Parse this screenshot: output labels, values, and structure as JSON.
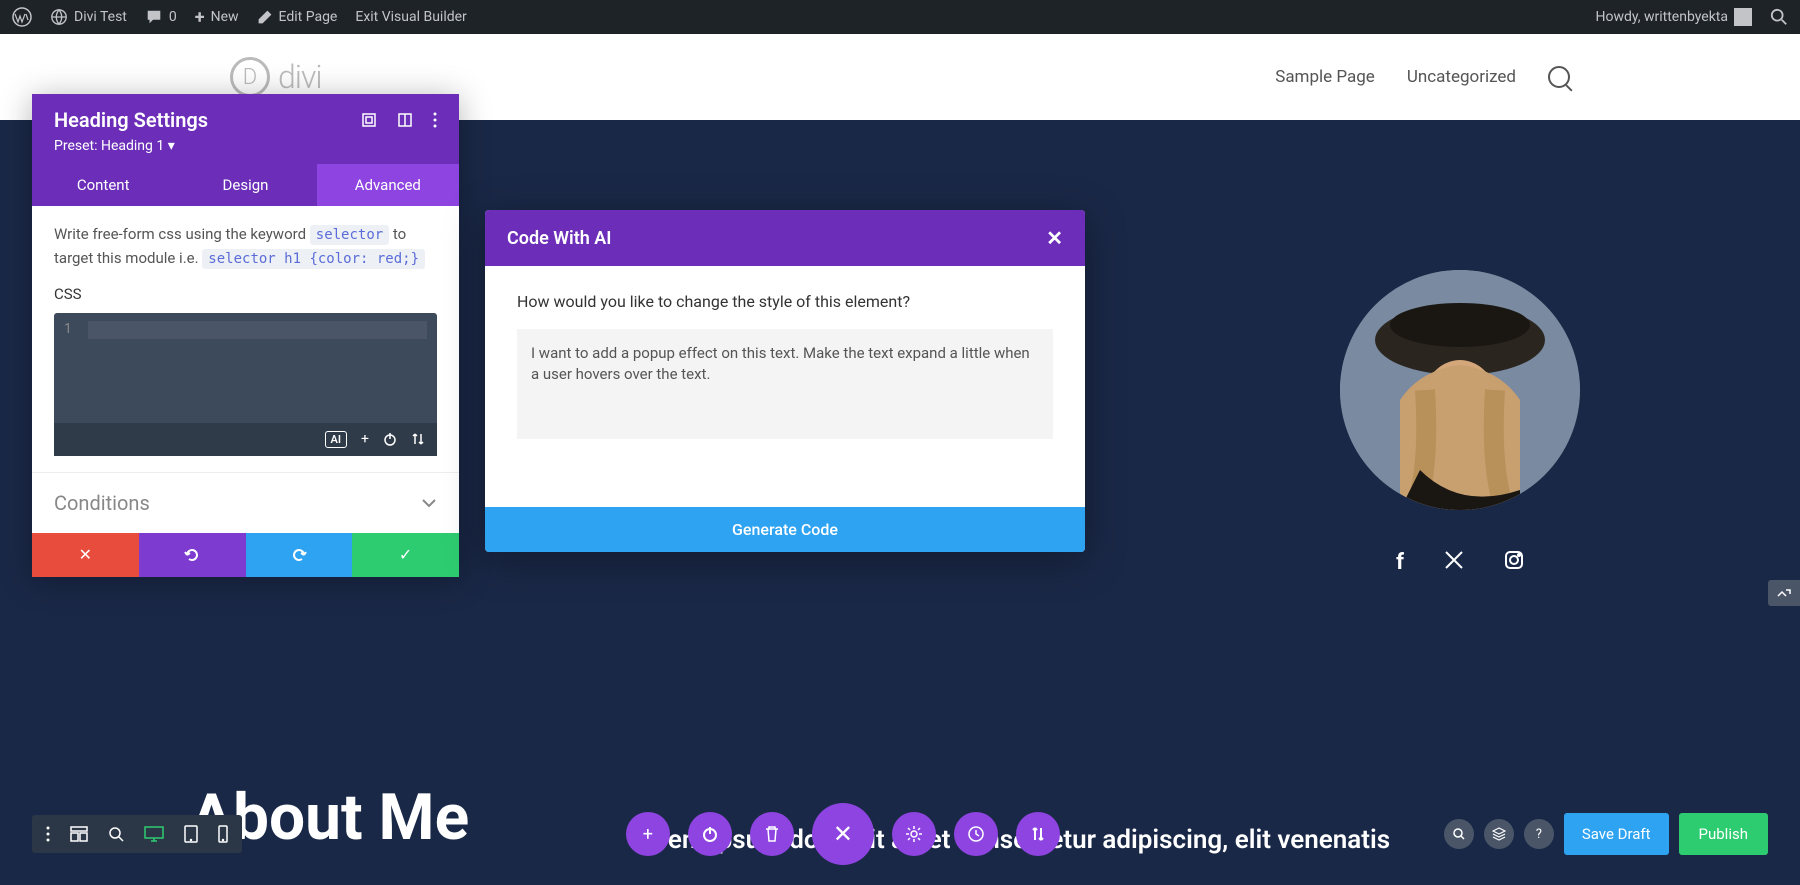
{
  "wp_bar": {
    "site_name": "Divi Test",
    "comments": "0",
    "new": "New",
    "edit_page": "Edit Page",
    "exit_vb": "Exit Visual Builder",
    "howdy": "Howdy, writtenbyekta"
  },
  "site_header": {
    "logo_text": "divi",
    "nav": {
      "sample": "Sample Page",
      "uncategorized": "Uncategorized"
    }
  },
  "settings_panel": {
    "title": "Heading Settings",
    "preset": "Preset: Heading 1",
    "tabs": {
      "content": "Content",
      "design": "Design",
      "advanced": "Advanced"
    },
    "help_pre": "Write free-form css using the keyword ",
    "help_mid": " to target this module i.e. ",
    "code1": "selector",
    "code2": "selector h1 {color: red;}",
    "css_label": "CSS",
    "line1": "1",
    "ai_badge": "AI",
    "conditions": "Conditions"
  },
  "ai_modal": {
    "title": "Code With AI",
    "question": "How would you like to change the style of this element?",
    "input_value": "I want to add a popup effect on this text. Make the text expand a little when a user hovers over the text.",
    "generate": "Generate Code"
  },
  "hero": {
    "heading": "About Me",
    "lorem": "Lorem ipsum dolor sit amet consectetur adipiscing, elit venenatis"
  },
  "builder_bar": {
    "save_draft": "Save Draft",
    "publish": "Publish"
  }
}
